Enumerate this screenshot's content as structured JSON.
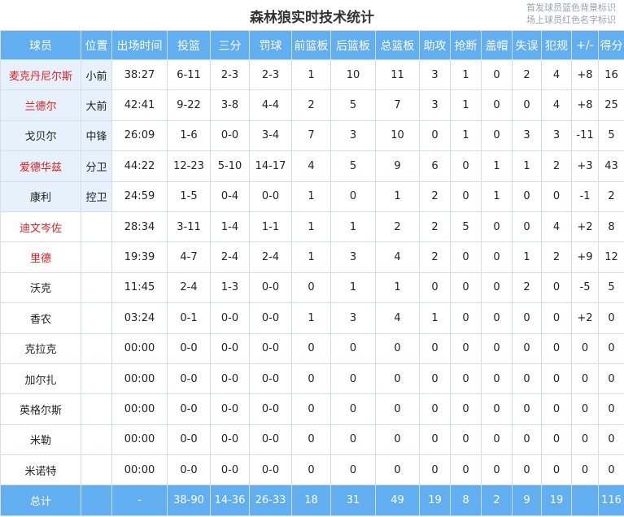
{
  "title": "森林狼实时技术统计",
  "legend": [
    "首发球员蓝色背景标识",
    "场上球员红色名字标识"
  ],
  "colors": {
    "header_bg": "#61aef0",
    "starter_bg": "#e6f1fb",
    "on_court_text": "#e02020"
  },
  "columns": [
    "球员",
    "位置",
    "出场时间",
    "投篮",
    "三分",
    "罚球",
    "前篮板",
    "后篮板",
    "总篮板",
    "助攻",
    "抢断",
    "盖帽",
    "失误",
    "犯规",
    "+/-",
    "得分"
  ],
  "players": [
    {
      "cells": [
        "麦克丹尼尔斯",
        "小前",
        "38:27",
        "6-11",
        "2-3",
        "2-3",
        "1",
        "10",
        "11",
        "3",
        "1",
        "0",
        "2",
        "4",
        "+8",
        "16"
      ],
      "starter": true,
      "on_court": true
    },
    {
      "cells": [
        "兰德尔",
        "大前",
        "42:41",
        "9-22",
        "3-8",
        "4-4",
        "2",
        "5",
        "7",
        "3",
        "1",
        "0",
        "0",
        "4",
        "+8",
        "25"
      ],
      "starter": true,
      "on_court": true
    },
    {
      "cells": [
        "戈贝尔",
        "中锋",
        "26:09",
        "1-6",
        "0-0",
        "3-4",
        "7",
        "3",
        "10",
        "0",
        "1",
        "0",
        "3",
        "3",
        "-11",
        "5"
      ],
      "starter": true,
      "on_court": false
    },
    {
      "cells": [
        "爱德华兹",
        "分卫",
        "44:22",
        "12-23",
        "5-10",
        "14-17",
        "4",
        "5",
        "9",
        "6",
        "0",
        "1",
        "1",
        "2",
        "+3",
        "43"
      ],
      "starter": true,
      "on_court": true
    },
    {
      "cells": [
        "康利",
        "控卫",
        "24:59",
        "1-5",
        "0-4",
        "0-0",
        "1",
        "0",
        "1",
        "2",
        "0",
        "1",
        "0",
        "0",
        "-1",
        "2"
      ],
      "starter": true,
      "on_court": false
    },
    {
      "cells": [
        "迪文岑佐",
        "",
        "28:34",
        "3-11",
        "1-4",
        "1-1",
        "1",
        "1",
        "2",
        "2",
        "5",
        "0",
        "0",
        "4",
        "+2",
        "8"
      ],
      "starter": false,
      "on_court": true
    },
    {
      "cells": [
        "里德",
        "",
        "19:39",
        "4-7",
        "2-4",
        "2-4",
        "1",
        "3",
        "4",
        "2",
        "0",
        "0",
        "1",
        "2",
        "+9",
        "12"
      ],
      "starter": false,
      "on_court": true
    },
    {
      "cells": [
        "沃克",
        "",
        "11:45",
        "2-4",
        "1-3",
        "0-0",
        "0",
        "1",
        "1",
        "0",
        "0",
        "0",
        "2",
        "0",
        "-5",
        "5"
      ],
      "starter": false,
      "on_court": false
    },
    {
      "cells": [
        "香农",
        "",
        "03:24",
        "0-1",
        "0-0",
        "0-0",
        "1",
        "3",
        "4",
        "1",
        "0",
        "0",
        "0",
        "0",
        "+2",
        "0"
      ],
      "starter": false,
      "on_court": false
    },
    {
      "cells": [
        "克拉克",
        "",
        "00:00",
        "0-0",
        "0-0",
        "0-0",
        "0",
        "0",
        "0",
        "0",
        "0",
        "0",
        "0",
        "0",
        "0",
        "0"
      ],
      "starter": false,
      "on_court": false
    },
    {
      "cells": [
        "加尔扎",
        "",
        "00:00",
        "0-0",
        "0-0",
        "0-0",
        "0",
        "0",
        "0",
        "0",
        "0",
        "0",
        "0",
        "0",
        "0",
        "0"
      ],
      "starter": false,
      "on_court": false
    },
    {
      "cells": [
        "英格尔斯",
        "",
        "00:00",
        "0-0",
        "0-0",
        "0-0",
        "0",
        "0",
        "0",
        "0",
        "0",
        "0",
        "0",
        "0",
        "0",
        "0"
      ],
      "starter": false,
      "on_court": false
    },
    {
      "cells": [
        "米勒",
        "",
        "00:00",
        "0-0",
        "0-0",
        "0-0",
        "0",
        "0",
        "0",
        "0",
        "0",
        "0",
        "0",
        "0",
        "0",
        "0"
      ],
      "starter": false,
      "on_court": false
    },
    {
      "cells": [
        "米诺特",
        "",
        "00:00",
        "0-0",
        "0-0",
        "0-0",
        "0",
        "0",
        "0",
        "0",
        "0",
        "0",
        "0",
        "0",
        "0",
        "0"
      ],
      "starter": false,
      "on_court": false
    }
  ],
  "totals": [
    "总计",
    "",
    "-",
    "38-90",
    "14-36",
    "26-33",
    "18",
    "31",
    "49",
    "19",
    "8",
    "2",
    "9",
    "19",
    "",
    "116"
  ]
}
